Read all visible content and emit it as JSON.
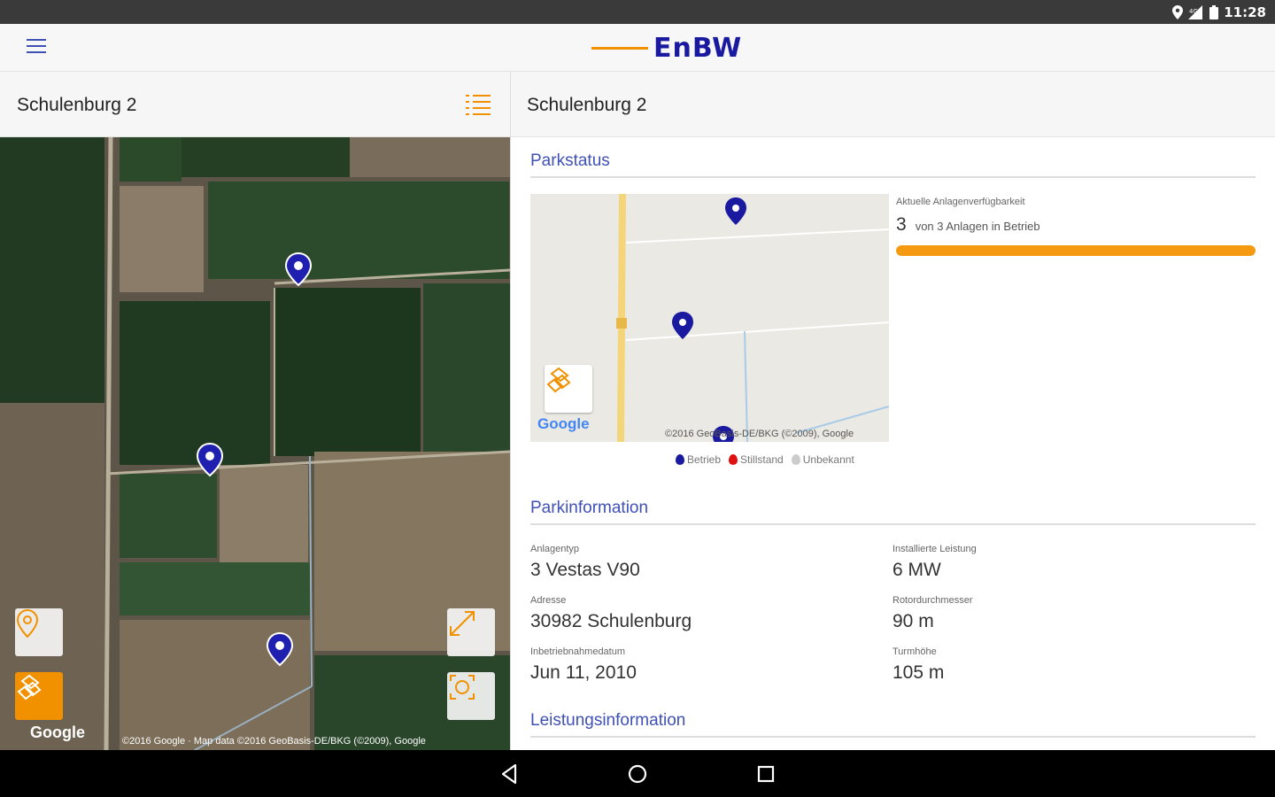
{
  "status_bar": {
    "time": "11:28",
    "icons": [
      "location-icon",
      "signal-icon",
      "battery-icon"
    ]
  },
  "app_bar": {
    "brand": "EnBW",
    "menu_icon": "hamburger-menu-icon"
  },
  "left_pane": {
    "title": "Schulenburg 2",
    "list_icon": "list-icon",
    "map": {
      "google_label": "Google",
      "credit": "©2016 Google · Map data ©2016 GeoBasis-DE/BKG (©2009), Google",
      "buttons": [
        "my-location-button",
        "map-layer-button",
        "fullscreen-button",
        "recenter-button"
      ]
    }
  },
  "right_pane": {
    "title": "Schulenburg 2",
    "parkstatus": {
      "heading": "Parkstatus",
      "availability_label": "Aktuelle Anlagenverfügbarkeit",
      "count": "3",
      "count_text": "von 3 Anlagen in Betrieb",
      "progress_fraction": 1.0,
      "map_google_label": "Google",
      "map_credit": "©2016 GeoBasis-DE/BKG (©2009), Google",
      "legend": [
        {
          "label": "Betrieb",
          "color": "#1a1aa0"
        },
        {
          "label": "Stillstand",
          "color": "#e01010"
        },
        {
          "label": "Unbekannt",
          "color": "#cccccc"
        }
      ]
    },
    "parkinformation": {
      "heading": "Parkinformation",
      "fields": [
        {
          "label": "Anlagentyp",
          "value": "3 Vestas V90"
        },
        {
          "label": "Installierte Leistung",
          "value": "6 MW"
        },
        {
          "label": "Adresse",
          "value": "30982 Schulenburg"
        },
        {
          "label": "Rotordurchmesser",
          "value": "90 m"
        },
        {
          "label": "Inbetriebnahmedatum",
          "value": "Jun 11, 2010"
        },
        {
          "label": "Turmhöhe",
          "value": "105 m"
        }
      ]
    },
    "leistungsinformation": {
      "heading": "Leistungsinformation"
    }
  },
  "colors": {
    "accent_orange": "#f29100",
    "brand_blue": "#1a1aa0",
    "heading_blue": "#3f51b5"
  },
  "nav_bar": {
    "buttons": [
      "back-icon",
      "home-icon",
      "recents-icon"
    ]
  }
}
